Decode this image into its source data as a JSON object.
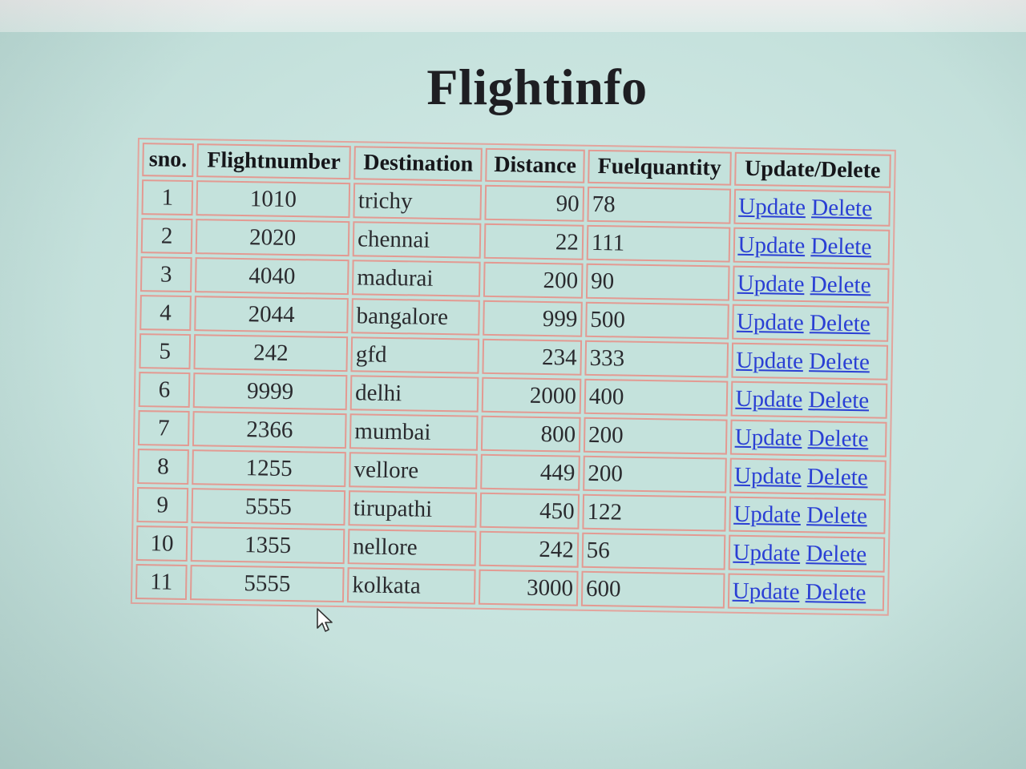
{
  "page": {
    "title": "Flightinfo"
  },
  "table": {
    "headers": [
      "sno.",
      "Flightnumber",
      "Destination",
      "Distance",
      "Fuelquantity",
      "Update/Delete"
    ],
    "update_label": "Update",
    "delete_label": "Delete",
    "rows": [
      {
        "sno": "1",
        "flightnumber": "1010",
        "destination": "trichy",
        "distance": "90",
        "fuelquantity": "78"
      },
      {
        "sno": "2",
        "flightnumber": "2020",
        "destination": "chennai",
        "distance": "22",
        "fuelquantity": "111"
      },
      {
        "sno": "3",
        "flightnumber": "4040",
        "destination": "madurai",
        "distance": "200",
        "fuelquantity": "90"
      },
      {
        "sno": "4",
        "flightnumber": "2044",
        "destination": "bangalore",
        "distance": "999",
        "fuelquantity": "500"
      },
      {
        "sno": "5",
        "flightnumber": "242",
        "destination": "gfd",
        "distance": "234",
        "fuelquantity": "333"
      },
      {
        "sno": "6",
        "flightnumber": "9999",
        "destination": "delhi",
        "distance": "2000",
        "fuelquantity": "400"
      },
      {
        "sno": "7",
        "flightnumber": "2366",
        "destination": "mumbai",
        "distance": "800",
        "fuelquantity": "200"
      },
      {
        "sno": "8",
        "flightnumber": "1255",
        "destination": "vellore",
        "distance": "449",
        "fuelquantity": "200"
      },
      {
        "sno": "9",
        "flightnumber": "5555",
        "destination": "tirupathi",
        "distance": "450",
        "fuelquantity": "122"
      },
      {
        "sno": "10",
        "flightnumber": "1355",
        "destination": "nellore",
        "distance": "242",
        "fuelquantity": "56"
      },
      {
        "sno": "11",
        "flightnumber": "5555",
        "destination": "kolkata",
        "distance": "3000",
        "fuelquantity": "600"
      }
    ]
  },
  "colors": {
    "background": "#c6e2dd",
    "border": "#e39a92",
    "link": "#2a3fd4",
    "heading": "#1e1e22"
  },
  "icons": {
    "cursor": "mouse-pointer-icon"
  }
}
